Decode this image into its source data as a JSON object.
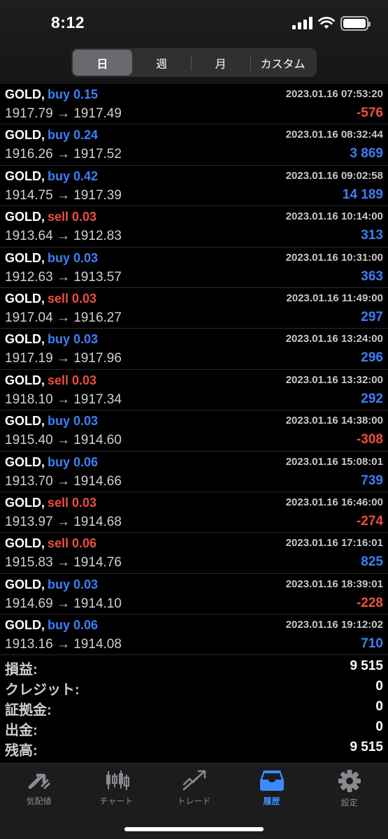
{
  "status_bar": {
    "time": "8:12"
  },
  "period_tabs": [
    "日",
    "週",
    "月",
    "カスタム"
  ],
  "trades": [
    {
      "symbol": "GOLD,",
      "type": "buy",
      "volume": "buy 0.15",
      "prices": "1917.79 → 1917.49",
      "time": "2023.01.16 07:53:20",
      "profit": "-576",
      "profit_sign": "neg"
    },
    {
      "symbol": "GOLD,",
      "type": "buy",
      "volume": "buy 0.24",
      "prices": "1916.26 → 1917.52",
      "time": "2023.01.16 08:32:44",
      "profit": "3 869",
      "profit_sign": "pos"
    },
    {
      "symbol": "GOLD,",
      "type": "buy",
      "volume": "buy 0.42",
      "prices": "1914.75 → 1917.39",
      "time": "2023.01.16 09:02:58",
      "profit": "14 189",
      "profit_sign": "pos"
    },
    {
      "symbol": "GOLD,",
      "type": "sell",
      "volume": "sell 0.03",
      "prices": "1913.64 → 1912.83",
      "time": "2023.01.16 10:14:00",
      "profit": "313",
      "profit_sign": "pos"
    },
    {
      "symbol": "GOLD,",
      "type": "buy",
      "volume": "buy 0.03",
      "prices": "1912.63 → 1913.57",
      "time": "2023.01.16 10:31:00",
      "profit": "363",
      "profit_sign": "pos"
    },
    {
      "symbol": "GOLD,",
      "type": "sell",
      "volume": "sell 0.03",
      "prices": "1917.04 → 1916.27",
      "time": "2023.01.16 11:49:00",
      "profit": "297",
      "profit_sign": "pos"
    },
    {
      "symbol": "GOLD,",
      "type": "buy",
      "volume": "buy 0.03",
      "prices": "1917.19 → 1917.96",
      "time": "2023.01.16 13:24:00",
      "profit": "296",
      "profit_sign": "pos"
    },
    {
      "symbol": "GOLD,",
      "type": "sell",
      "volume": "sell 0.03",
      "prices": "1918.10 → 1917.34",
      "time": "2023.01.16 13:32:00",
      "profit": "292",
      "profit_sign": "pos"
    },
    {
      "symbol": "GOLD,",
      "type": "buy",
      "volume": "buy 0.03",
      "prices": "1915.40 → 1914.60",
      "time": "2023.01.16 14:38:00",
      "profit": "-308",
      "profit_sign": "neg"
    },
    {
      "symbol": "GOLD,",
      "type": "buy",
      "volume": "buy 0.06",
      "prices": "1913.70 → 1914.66",
      "time": "2023.01.16 15:08:01",
      "profit": "739",
      "profit_sign": "pos"
    },
    {
      "symbol": "GOLD,",
      "type": "sell",
      "volume": "sell 0.03",
      "prices": "1913.97 → 1914.68",
      "time": "2023.01.16 16:46:00",
      "profit": "-274",
      "profit_sign": "neg"
    },
    {
      "symbol": "GOLD,",
      "type": "sell",
      "volume": "sell 0.06",
      "prices": "1915.83 → 1914.76",
      "time": "2023.01.16 17:16:01",
      "profit": "825",
      "profit_sign": "pos"
    },
    {
      "symbol": "GOLD,",
      "type": "buy",
      "volume": "buy 0.03",
      "prices": "1914.69 → 1914.10",
      "time": "2023.01.16 18:39:01",
      "profit": "-228",
      "profit_sign": "neg"
    },
    {
      "symbol": "GOLD,",
      "type": "buy",
      "volume": "buy 0.06",
      "prices": "1913.16 → 1914.08",
      "time": "2023.01.16 19:12:02",
      "profit": "710",
      "profit_sign": "pos"
    }
  ],
  "summary": [
    {
      "label": "損益:",
      "value": "9 515"
    },
    {
      "label": "クレジット:",
      "value": "0"
    },
    {
      "label": "証拠金:",
      "value": "0"
    },
    {
      "label": "出金:",
      "value": "0"
    },
    {
      "label": "残高:",
      "value": "9 515"
    }
  ],
  "tabbar": [
    {
      "label": "気配値",
      "icon": "quotes-icon",
      "active": false
    },
    {
      "label": "チャート",
      "icon": "chart-icon",
      "active": false
    },
    {
      "label": "トレード",
      "icon": "trade-icon",
      "active": false
    },
    {
      "label": "履歴",
      "icon": "history-icon",
      "active": true
    },
    {
      "label": "設定",
      "icon": "settings-icon",
      "active": false
    }
  ],
  "colors": {
    "buy": "#3d7ff5",
    "sell": "#ec4f3f",
    "active_tab": "#3d8aff",
    "inactive_tab": "#8a8a8e"
  }
}
